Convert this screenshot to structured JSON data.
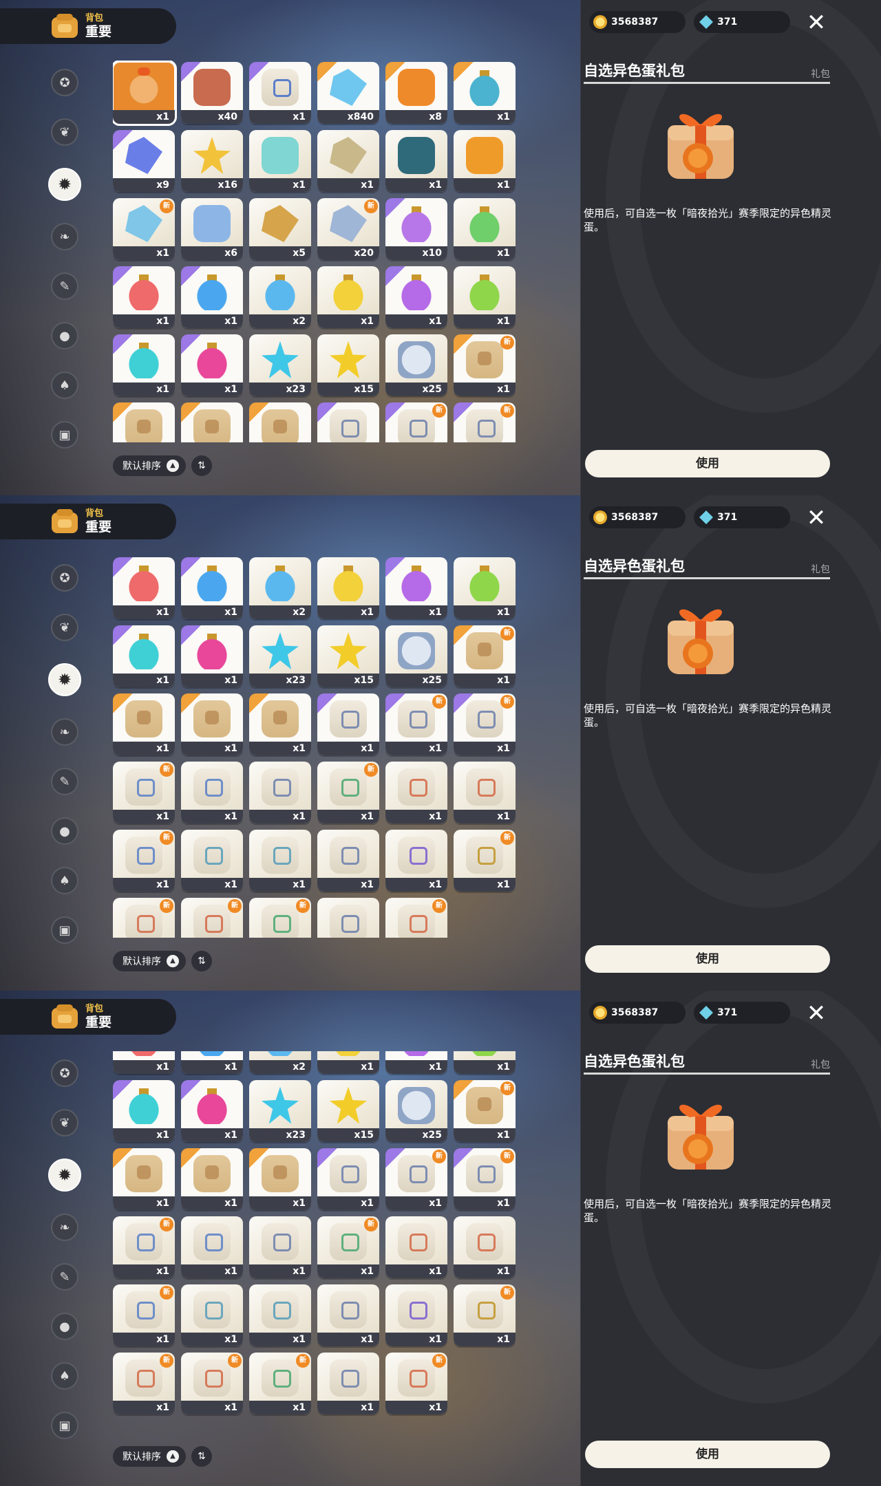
{
  "header": {
    "small": "背包",
    "big": "重要"
  },
  "nav": [
    "star-icon",
    "sprout-icon",
    "seal-icon",
    "leaf-icon",
    "scroll-icon",
    "ball-icon",
    "acorn-icon",
    "chest-icon"
  ],
  "nav_active": 2,
  "currency": {
    "coins": "3568387",
    "gems": "371"
  },
  "detail": {
    "title": "自选异色蛋礼包",
    "category": "礼包",
    "description": "使用后，可自选一枚「暗夜拾光」赛季限定的异色精灵蛋。",
    "use_label": "使用"
  },
  "sort": {
    "label": "默认排序"
  },
  "grid_scroll_rows": [
    0,
    3,
    3.6
  ],
  "items": [
    {
      "kind": "gift",
      "c": "#e8a45b",
      "qty": "x1",
      "rarity": "sel",
      "new": false
    },
    {
      "kind": "round",
      "c": "#c96b4f",
      "qty": "x40",
      "rarity": "purple",
      "new": false
    },
    {
      "kind": "paper",
      "c": "#5b7fc9",
      "qty": "x1",
      "rarity": "purple",
      "new": false
    },
    {
      "kind": "gem",
      "c": "#6fc7ef",
      "qty": "x840",
      "rarity": "orange",
      "new": false
    },
    {
      "kind": "round",
      "c": "#ef8a2a",
      "qty": "x8",
      "rarity": "orange",
      "new": false
    },
    {
      "kind": "bottle",
      "c": "#4bb3cf",
      "qty": "x1",
      "rarity": "orange",
      "new": false
    },
    {
      "kind": "gem",
      "c": "#6a7ee8",
      "qty": "x9",
      "rarity": "purple",
      "new": false
    },
    {
      "kind": "star",
      "c": "#f2c23a",
      "qty": "x16",
      "rarity": "",
      "new": false
    },
    {
      "kind": "round",
      "c": "#7fd6d3",
      "qty": "x1",
      "rarity": "",
      "new": false
    },
    {
      "kind": "gem",
      "c": "#c9b98a",
      "qty": "x1",
      "rarity": "",
      "new": false
    },
    {
      "kind": "round",
      "c": "#2f6a7a",
      "qty": "x1",
      "rarity": "",
      "new": false
    },
    {
      "kind": "round",
      "c": "#ef9b2a",
      "qty": "x1",
      "rarity": "",
      "new": false
    },
    {
      "kind": "gem",
      "c": "#7fc6e8",
      "qty": "x1",
      "rarity": "",
      "new": true
    },
    {
      "kind": "round",
      "c": "#8db6e6",
      "qty": "x6",
      "rarity": "",
      "new": false
    },
    {
      "kind": "gem",
      "c": "#d6a44a",
      "qty": "x5",
      "rarity": "",
      "new": false
    },
    {
      "kind": "gem",
      "c": "#9fb6d6",
      "qty": "x20",
      "rarity": "",
      "new": true
    },
    {
      "kind": "bottle",
      "c": "#b777e8",
      "qty": "x10",
      "rarity": "purple",
      "new": false
    },
    {
      "kind": "bottle",
      "c": "#6fcf6a",
      "qty": "x1",
      "rarity": "",
      "new": false
    },
    {
      "kind": "bottle",
      "c": "#ef6a6a",
      "qty": "x1",
      "rarity": "purple",
      "new": false
    },
    {
      "kind": "bottle",
      "c": "#4aa7ef",
      "qty": "x1",
      "rarity": "purple",
      "new": false
    },
    {
      "kind": "bottle",
      "c": "#5bb8ef",
      "qty": "x2",
      "rarity": "",
      "new": false
    },
    {
      "kind": "bottle",
      "c": "#f2d13a",
      "qty": "x1",
      "rarity": "",
      "new": false
    },
    {
      "kind": "bottle",
      "c": "#b56ae8",
      "qty": "x1",
      "rarity": "purple",
      "new": false
    },
    {
      "kind": "bottle",
      "c": "#8fd64a",
      "qty": "x1",
      "rarity": "",
      "new": false
    },
    {
      "kind": "bottle",
      "c": "#3fd0d6",
      "qty": "x1",
      "rarity": "purple",
      "new": false
    },
    {
      "kind": "bottle",
      "c": "#e8479a",
      "qty": "x1",
      "rarity": "purple",
      "new": false
    },
    {
      "kind": "star",
      "c": "#3fc7e8",
      "qty": "x23",
      "rarity": "",
      "new": false
    },
    {
      "kind": "star",
      "c": "#f2cd2a",
      "qty": "x15",
      "rarity": "",
      "new": false
    },
    {
      "kind": "coin",
      "c": "#8fa5c6",
      "qty": "x25",
      "rarity": "",
      "new": false
    },
    {
      "kind": "scroll",
      "c": "#b88a52",
      "qty": "x1",
      "rarity": "orange",
      "new": true
    },
    {
      "kind": "scroll",
      "c": "#b88a52",
      "qty": "x1",
      "rarity": "orange",
      "new": false
    },
    {
      "kind": "scroll",
      "c": "#b88a52",
      "qty": "x1",
      "rarity": "orange",
      "new": false
    },
    {
      "kind": "scroll",
      "c": "#b88a52",
      "qty": "x1",
      "rarity": "orange",
      "new": false
    },
    {
      "kind": "paper",
      "c": "#7d8db1",
      "qty": "x1",
      "rarity": "purple",
      "new": false
    },
    {
      "kind": "paper",
      "c": "#7d8db1",
      "qty": "x1",
      "rarity": "purple",
      "new": true
    },
    {
      "kind": "paper",
      "c": "#7d8db1",
      "qty": "x1",
      "rarity": "purple",
      "new": true
    },
    {
      "kind": "paper",
      "c": "#6e8ec9",
      "qty": "x1",
      "rarity": "",
      "new": true
    },
    {
      "kind": "paper",
      "c": "#6e8ec9",
      "qty": "x1",
      "rarity": "",
      "new": false
    },
    {
      "kind": "paper",
      "c": "#7d8db1",
      "qty": "x1",
      "rarity": "",
      "new": false
    },
    {
      "kind": "paper",
      "c": "#5fb07d",
      "qty": "x1",
      "rarity": "",
      "new": true
    },
    {
      "kind": "paper",
      "c": "#d77a5a",
      "qty": "x1",
      "rarity": "",
      "new": false
    },
    {
      "kind": "paper",
      "c": "#d77a5a",
      "qty": "x1",
      "rarity": "",
      "new": false
    },
    {
      "kind": "paper",
      "c": "#6e8ec9",
      "qty": "x1",
      "rarity": "",
      "new": true
    },
    {
      "kind": "paper",
      "c": "#6aa6bd",
      "qty": "x1",
      "rarity": "",
      "new": false
    },
    {
      "kind": "paper",
      "c": "#6aa6bd",
      "qty": "x1",
      "rarity": "",
      "new": false
    },
    {
      "kind": "paper",
      "c": "#7d8db1",
      "qty": "x1",
      "rarity": "",
      "new": false
    },
    {
      "kind": "paper",
      "c": "#8a6fd0",
      "qty": "x1",
      "rarity": "",
      "new": false
    },
    {
      "kind": "paper",
      "c": "#c6a040",
      "qty": "x1",
      "rarity": "",
      "new": true
    },
    {
      "kind": "paper",
      "c": "#d77a5a",
      "qty": "x1",
      "rarity": "",
      "new": true
    },
    {
      "kind": "paper",
      "c": "#d77a5a",
      "qty": "x1",
      "rarity": "",
      "new": true
    },
    {
      "kind": "paper",
      "c": "#5fb07d",
      "qty": "x1",
      "rarity": "",
      "new": true
    },
    {
      "kind": "paper",
      "c": "#7d8db1",
      "qty": "x1",
      "rarity": "",
      "new": false
    },
    {
      "kind": "paper",
      "c": "#d77a5a",
      "qty": "x1",
      "rarity": "",
      "new": true
    }
  ]
}
